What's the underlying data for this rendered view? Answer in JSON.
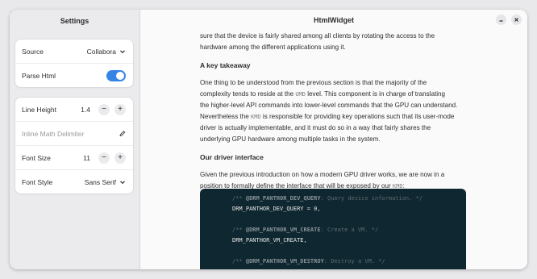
{
  "sidebar": {
    "title": "Settings",
    "source": {
      "label": "Source",
      "value": "Collabora"
    },
    "parse_html": {
      "label": "Parse Html",
      "enabled": true
    },
    "line_height": {
      "label": "Line Height",
      "value": "1.4"
    },
    "inline_math": {
      "label": "Inline Math Delimiter"
    },
    "font_size": {
      "label": "Font Size",
      "value": "11"
    },
    "font_style": {
      "label": "Font Style",
      "value": "Sans Serif"
    },
    "minus": "−",
    "plus": "+"
  },
  "window": {
    "title": "HtmlWidget"
  },
  "article": {
    "para1_line2": "sure that the device is fairly shared among all clients by rotating the access to the",
    "para1_line3": "hardware among the different applications using it.",
    "heading1": "A key takeaway",
    "para2_l1": "One thing to be understood from the previous section is that the majority of the",
    "para2_l2a": "complexity tends to reside at the ",
    "para2_l2code": "UMD",
    "para2_l2b": " level. This component is in charge of translating",
    "para2_l3": "the higher-level API commands into lower-level commands that the GPU can understand.",
    "para2_l4a": "Nevertheless the ",
    "para2_l4code": "KMD",
    "para2_l4b": " is responsible for providing key operations such that its user-mode",
    "para2_l5": "driver is actually implementable, and it must do so in a way that fairly shares the",
    "para2_l6": "underlying GPU hardware among multiple tasks in the system.",
    "heading2": "Our driver interface",
    "para3_l1": "Given the previous introduction on how a modern GPU driver works, we are now in a",
    "para3_l2a": "position to formally define the interface that will be exposed by our ",
    "para3_l2code": "KMD",
    "para3_l2b": ":"
  },
  "code": {
    "c1_pre": "/** ",
    "c1_name": "@DRM_PANTHOR_DEV_QUERY",
    "c1_post": ": Query device information. */",
    "l1": "DRM_PANTHOR_DEV_QUERY = 0,",
    "c2_pre": "/** ",
    "c2_name": "@DRM_PANTHOR_VM_CREATE",
    "c2_post": ": Create a VM. */",
    "l2": "DRM_PANTHOR_VM_CREATE,",
    "c3_pre": "/** ",
    "c3_name": "@DRM_PANTHOR_VM_DESTROY",
    "c3_post": ": Destroy a VM. */"
  }
}
